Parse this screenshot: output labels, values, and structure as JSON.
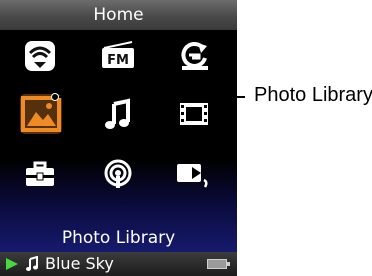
{
  "header": {
    "title": "Home"
  },
  "menu": {
    "items": [
      {
        "icon": "wireless-icon"
      },
      {
        "icon": "fm-radio-icon",
        "label": "FM"
      },
      {
        "icon": "sync-icon"
      },
      {
        "icon": "photo-library-icon",
        "selected": true
      },
      {
        "icon": "music-note-icon"
      },
      {
        "icon": "video-film-icon"
      },
      {
        "icon": "toolbox-settings-icon"
      },
      {
        "icon": "podcast-icon"
      },
      {
        "icon": "now-playing-icon"
      }
    ],
    "selected_caption": "Photo Library"
  },
  "status_bar": {
    "track": "Blue Sky",
    "play_state": "playing"
  },
  "callout": {
    "label": "Photo Library"
  },
  "colors": {
    "selection_orange": "#f08a22",
    "play_green": "#49d840",
    "icon_white": "#ffffff"
  }
}
